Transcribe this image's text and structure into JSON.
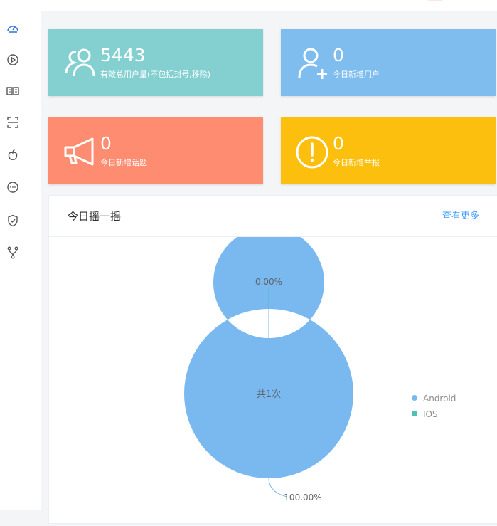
{
  "sidebar": {
    "items": [
      {
        "icon": "dashboard-icon"
      },
      {
        "icon": "play-circle-icon"
      },
      {
        "icon": "book-icon"
      },
      {
        "icon": "scan-icon"
      },
      {
        "icon": "apple-icon"
      },
      {
        "icon": "chat-icon"
      },
      {
        "icon": "shield-check-icon"
      },
      {
        "icon": "fork-icon"
      }
    ]
  },
  "cards": [
    {
      "value": "5443",
      "label": "有效总用户量(不包括封号,移除)",
      "color": "#84cfd0",
      "icon": "users-icon"
    },
    {
      "value": "0",
      "label": "今日新增用户",
      "color": "#7fbdef",
      "icon": "add-user-icon"
    },
    {
      "value": "0",
      "label": "今日新增话题",
      "color": "#fd8c70",
      "icon": "megaphone-icon"
    },
    {
      "value": "0",
      "label": "今日新增举报",
      "color": "#fcbf0e",
      "icon": "alert-icon"
    }
  ],
  "panel": {
    "title": "今日摇一摇",
    "more_link": "查看更多"
  },
  "chart_data": {
    "type": "pie",
    "center_text": "共1次",
    "series": [
      {
        "name": "Android",
        "value": 1,
        "percent_label": "100.00%",
        "color": "#7ab8f0"
      },
      {
        "name": "IOS",
        "value": 0,
        "percent_label": "0.00%",
        "color": "#4ec0b4"
      }
    ],
    "legend_position": "right"
  }
}
